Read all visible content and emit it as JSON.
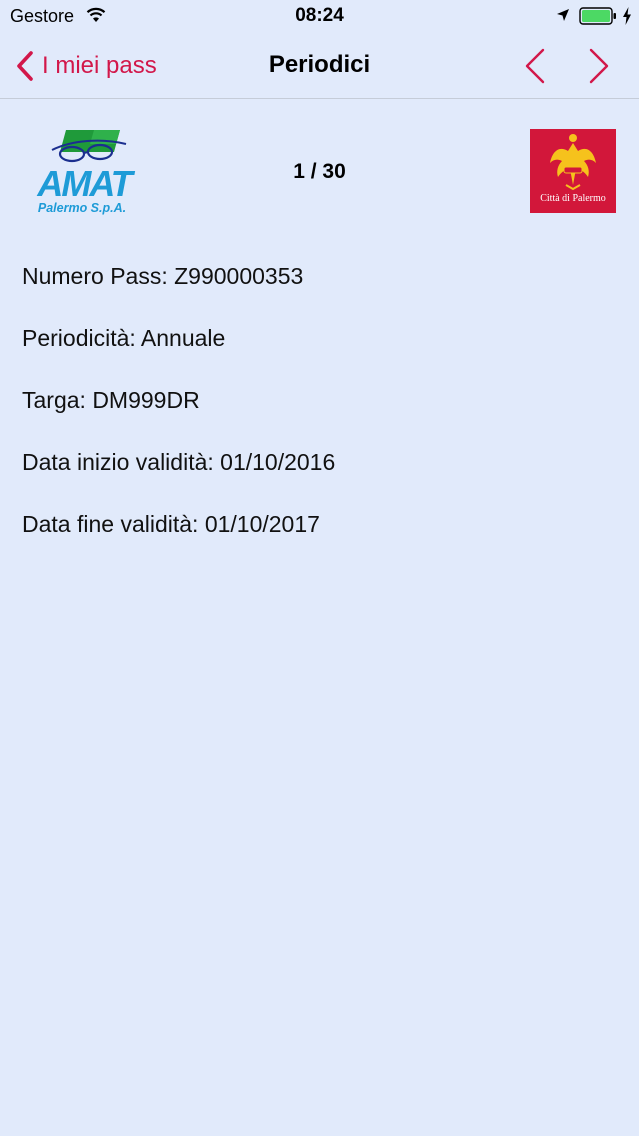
{
  "status_bar": {
    "carrier": "Gestore",
    "time": "08:24",
    "battery_color": "#4cd964"
  },
  "nav": {
    "back_label": "I miei pass",
    "title": "Periodici",
    "accent_color": "#d2174a"
  },
  "header": {
    "counter": "1 / 30",
    "amat_logo": {
      "brand": "AMAT",
      "subtitle": "Palermo S.p.A."
    },
    "palermo_logo": {
      "text": "Città di Palermo",
      "color": "#d2173a"
    }
  },
  "pass": {
    "numero": "Numero Pass: Z990000353",
    "periodicita": "Periodicità: Annuale",
    "targa": "Targa: DM999DR",
    "data_inizio": "Data inizio validità: 01/10/2016",
    "data_fine": "Data fine validità: 01/10/2017"
  },
  "icons": {
    "wifi": "wifi-icon",
    "location": "location-arrow-icon",
    "battery": "battery-icon",
    "charging": "charging-bolt-icon",
    "back": "chevron-left-icon",
    "prev": "chevron-left-icon",
    "next": "chevron-right-icon"
  }
}
